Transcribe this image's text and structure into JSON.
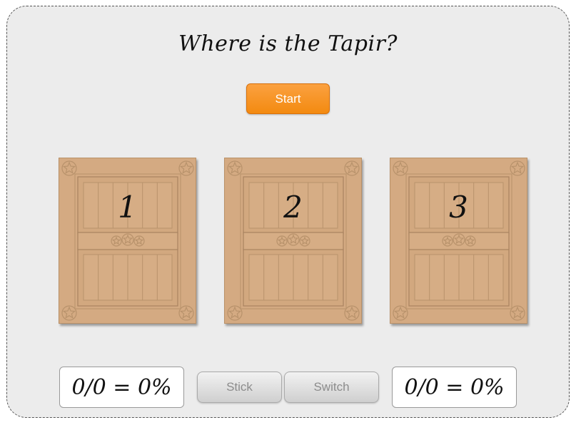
{
  "title": "Where is the Tapir?",
  "start_button": "Start",
  "doors": [
    {
      "label": "1"
    },
    {
      "label": "2"
    },
    {
      "label": "3"
    }
  ],
  "buttons": {
    "stick": "Stick",
    "switch": "Switch"
  },
  "scores": {
    "left": "0/0 = 0%",
    "right": "0/0 = 0%"
  },
  "colors": {
    "door": "#d4aa82",
    "start": "#f7931e",
    "background": "#ececec"
  }
}
